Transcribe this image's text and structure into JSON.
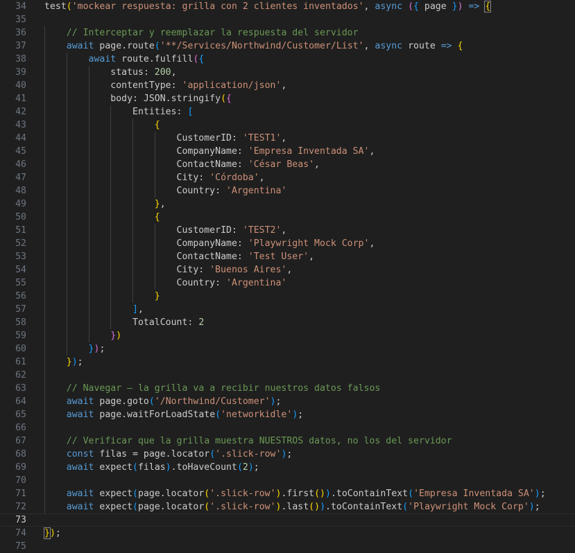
{
  "editor": {
    "language": "typescript",
    "current_line": 73,
    "lines": [
      {
        "n": "34",
        "t": [
          [
            "p",
            "test"
          ],
          [
            "b1",
            "("
          ],
          [
            "s",
            "'mockear respuesta: grilla con 2 clientes inventados'"
          ],
          [
            "p",
            ", "
          ],
          [
            "k",
            "async"
          ],
          [
            "p",
            " "
          ],
          [
            "b2",
            "("
          ],
          [
            "b3",
            "{"
          ],
          [
            "p",
            " page "
          ],
          [
            "b3",
            "}"
          ],
          [
            "b2",
            ")"
          ],
          [
            "p",
            " "
          ],
          [
            "k",
            "=>"
          ],
          [
            "p",
            " "
          ],
          [
            "b2c",
            "{"
          ]
        ]
      },
      {
        "n": "35",
        "t": []
      },
      {
        "n": "36",
        "t": [
          [
            "p",
            "    "
          ],
          [
            "c",
            "// Interceptar y reemplazar la respuesta del servidor"
          ]
        ]
      },
      {
        "n": "37",
        "t": [
          [
            "p",
            "    "
          ],
          [
            "k",
            "await"
          ],
          [
            "p",
            " page.route"
          ],
          [
            "b3",
            "("
          ],
          [
            "s",
            "'**/Services/Northwind/Customer/List'"
          ],
          [
            "p",
            ", "
          ],
          [
            "k",
            "async"
          ],
          [
            "p",
            " route "
          ],
          [
            "k",
            "=>"
          ],
          [
            "p",
            " "
          ],
          [
            "b1",
            "{"
          ]
        ]
      },
      {
        "n": "38",
        "t": [
          [
            "p",
            "        "
          ],
          [
            "k",
            "await"
          ],
          [
            "p",
            " route.fulfill"
          ],
          [
            "b2",
            "("
          ],
          [
            "b3",
            "{"
          ]
        ]
      },
      {
        "n": "39",
        "t": [
          [
            "p",
            "            status: "
          ],
          [
            "n",
            "200"
          ],
          [
            "p",
            ","
          ]
        ]
      },
      {
        "n": "40",
        "t": [
          [
            "p",
            "            contentType: "
          ],
          [
            "s",
            "'application/json'"
          ],
          [
            "p",
            ","
          ]
        ]
      },
      {
        "n": "41",
        "t": [
          [
            "p",
            "            body: JSON.stringify"
          ],
          [
            "b1",
            "("
          ],
          [
            "b2",
            "{"
          ]
        ]
      },
      {
        "n": "42",
        "t": [
          [
            "p",
            "                Entities: "
          ],
          [
            "b3",
            "["
          ]
        ]
      },
      {
        "n": "43",
        "t": [
          [
            "p",
            "                    "
          ],
          [
            "b1",
            "{"
          ]
        ]
      },
      {
        "n": "44",
        "t": [
          [
            "p",
            "                        CustomerID: "
          ],
          [
            "s",
            "'TEST1'"
          ],
          [
            "p",
            ","
          ]
        ]
      },
      {
        "n": "45",
        "t": [
          [
            "p",
            "                        CompanyName: "
          ],
          [
            "s",
            "'Empresa Inventada SA'"
          ],
          [
            "p",
            ","
          ]
        ]
      },
      {
        "n": "46",
        "t": [
          [
            "p",
            "                        ContactName: "
          ],
          [
            "s",
            "'César Beas'"
          ],
          [
            "p",
            ","
          ]
        ]
      },
      {
        "n": "47",
        "t": [
          [
            "p",
            "                        City: "
          ],
          [
            "s",
            "'Córdoba'"
          ],
          [
            "p",
            ","
          ]
        ]
      },
      {
        "n": "48",
        "t": [
          [
            "p",
            "                        Country: "
          ],
          [
            "s",
            "'Argentina'"
          ]
        ]
      },
      {
        "n": "49",
        "t": [
          [
            "p",
            "                    "
          ],
          [
            "b1",
            "}"
          ],
          [
            "p",
            ","
          ]
        ]
      },
      {
        "n": "50",
        "t": [
          [
            "p",
            "                    "
          ],
          [
            "b1",
            "{"
          ]
        ]
      },
      {
        "n": "51",
        "t": [
          [
            "p",
            "                        CustomerID: "
          ],
          [
            "s",
            "'TEST2'"
          ],
          [
            "p",
            ","
          ]
        ]
      },
      {
        "n": "52",
        "t": [
          [
            "p",
            "                        CompanyName: "
          ],
          [
            "s",
            "'Playwright Mock Corp'"
          ],
          [
            "p",
            ","
          ]
        ]
      },
      {
        "n": "53",
        "t": [
          [
            "p",
            "                        ContactName: "
          ],
          [
            "s",
            "'Test User'"
          ],
          [
            "p",
            ","
          ]
        ]
      },
      {
        "n": "54",
        "t": [
          [
            "p",
            "                        City: "
          ],
          [
            "s",
            "'Buenos Aires'"
          ],
          [
            "p",
            ","
          ]
        ]
      },
      {
        "n": "55",
        "t": [
          [
            "p",
            "                        Country: "
          ],
          [
            "s",
            "'Argentina'"
          ]
        ]
      },
      {
        "n": "56",
        "t": [
          [
            "p",
            "                    "
          ],
          [
            "b1",
            "}"
          ]
        ]
      },
      {
        "n": "57",
        "t": [
          [
            "p",
            "                "
          ],
          [
            "b3",
            "]"
          ],
          [
            "p",
            ","
          ]
        ]
      },
      {
        "n": "58",
        "t": [
          [
            "p",
            "                TotalCount: "
          ],
          [
            "n",
            "2"
          ]
        ]
      },
      {
        "n": "59",
        "t": [
          [
            "p",
            "            "
          ],
          [
            "b2",
            "}"
          ],
          [
            "b1",
            ")"
          ]
        ]
      },
      {
        "n": "60",
        "t": [
          [
            "p",
            "        "
          ],
          [
            "b3",
            "}"
          ],
          [
            "b2",
            ")"
          ],
          [
            "p",
            ";"
          ]
        ]
      },
      {
        "n": "61",
        "t": [
          [
            "p",
            "    "
          ],
          [
            "b1",
            "}"
          ],
          [
            "b3",
            ")"
          ],
          [
            "p",
            ";"
          ]
        ]
      },
      {
        "n": "62",
        "t": []
      },
      {
        "n": "63",
        "t": [
          [
            "p",
            "    "
          ],
          [
            "c",
            "// Navegar — la grilla va a recibir nuestros datos falsos"
          ]
        ]
      },
      {
        "n": "64",
        "t": [
          [
            "p",
            "    "
          ],
          [
            "k",
            "await"
          ],
          [
            "p",
            " page.goto"
          ],
          [
            "b3",
            "("
          ],
          [
            "s",
            "'/Northwind/Customer'"
          ],
          [
            "b3",
            ")"
          ],
          [
            "p",
            ";"
          ]
        ]
      },
      {
        "n": "65",
        "t": [
          [
            "p",
            "    "
          ],
          [
            "k",
            "await"
          ],
          [
            "p",
            " page.waitForLoadState"
          ],
          [
            "b3",
            "("
          ],
          [
            "s",
            "'networkidle'"
          ],
          [
            "b3",
            ")"
          ],
          [
            "p",
            ";"
          ]
        ]
      },
      {
        "n": "66",
        "t": []
      },
      {
        "n": "67",
        "t": [
          [
            "p",
            "    "
          ],
          [
            "c",
            "// Verificar que la grilla muestra NUESTROS datos, no los del servidor"
          ]
        ]
      },
      {
        "n": "68",
        "t": [
          [
            "p",
            "    "
          ],
          [
            "k",
            "const"
          ],
          [
            "p",
            " filas = page.locator"
          ],
          [
            "b3",
            "("
          ],
          [
            "s",
            "'.slick-row'"
          ],
          [
            "b3",
            ")"
          ],
          [
            "p",
            ";"
          ]
        ]
      },
      {
        "n": "69",
        "t": [
          [
            "p",
            "    "
          ],
          [
            "k",
            "await"
          ],
          [
            "p",
            " expect"
          ],
          [
            "b3",
            "("
          ],
          [
            "p",
            "filas"
          ],
          [
            "b3",
            ")"
          ],
          [
            "p",
            ".toHaveCount"
          ],
          [
            "b3",
            "("
          ],
          [
            "n",
            "2"
          ],
          [
            "b3",
            ")"
          ],
          [
            "p",
            ";"
          ]
        ]
      },
      {
        "n": "70",
        "t": []
      },
      {
        "n": "71",
        "t": [
          [
            "p",
            "    "
          ],
          [
            "k",
            "await"
          ],
          [
            "p",
            " expect"
          ],
          [
            "b3",
            "("
          ],
          [
            "p",
            "page.locator"
          ],
          [
            "b1",
            "("
          ],
          [
            "s",
            "'.slick-row'"
          ],
          [
            "b1",
            ")"
          ],
          [
            "p",
            ".first"
          ],
          [
            "b1",
            "()"
          ],
          [
            "b3",
            ")"
          ],
          [
            "p",
            ".toContainText"
          ],
          [
            "b3",
            "("
          ],
          [
            "s",
            "'Empresa Inventada SA'"
          ],
          [
            "b3",
            ")"
          ],
          [
            "p",
            ";"
          ]
        ]
      },
      {
        "n": "72",
        "t": [
          [
            "p",
            "    "
          ],
          [
            "k",
            "await"
          ],
          [
            "p",
            " expect"
          ],
          [
            "b3",
            "("
          ],
          [
            "p",
            "page.locator"
          ],
          [
            "b1",
            "("
          ],
          [
            "s",
            "'.slick-row'"
          ],
          [
            "b1",
            ")"
          ],
          [
            "p",
            ".last"
          ],
          [
            "b1",
            "()"
          ],
          [
            "b3",
            ")"
          ],
          [
            "p",
            ".toContainText"
          ],
          [
            "b3",
            "("
          ],
          [
            "s",
            "'Playwright Mock Corp'"
          ],
          [
            "b3",
            ")"
          ],
          [
            "p",
            ";"
          ]
        ]
      },
      {
        "n": "73",
        "t": []
      },
      {
        "n": "74",
        "t": [
          [
            "b2c",
            "}"
          ],
          [
            "b1",
            ")"
          ],
          [
            "p",
            ";"
          ]
        ]
      },
      {
        "n": "75",
        "t": []
      }
    ]
  }
}
